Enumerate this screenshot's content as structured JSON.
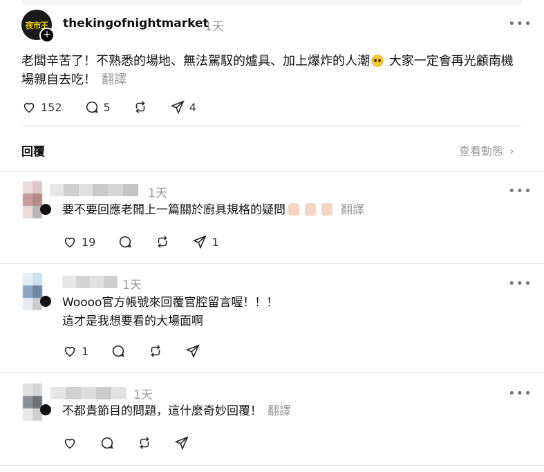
{
  "post": {
    "username": "thekingofnightmarket",
    "time": "1天",
    "avatar_text": "夜市王",
    "text": "老闆辛苦了！不熟悉的場地、無法駕馭的爐具、加上爆炸的人潮",
    "text_2": " 大家一定會再光顧南機場親自去吃！",
    "translate": "翻譯",
    "likes": "152",
    "comments": "5",
    "shares": "4"
  },
  "replies_header": "回覆",
  "activity_link": "查看動態",
  "comments": [
    {
      "time": "1天",
      "text": "要不要回應老闆上一篇關於廚具規格的疑問",
      "translate": "翻譯",
      "likes": "19",
      "comments": "",
      "reposts": "",
      "shares": "1"
    },
    {
      "time": "1天",
      "text": "Woooo官方帳號來回覆官腔留言喔！！！",
      "text_2": "這才是我想要看的大場面啊",
      "likes": "1"
    },
    {
      "time": "1天",
      "text": "不都貴節目的問題，這什麼奇妙回覆！",
      "translate": "翻譯"
    }
  ],
  "icons": [
    "heart-icon",
    "comment-icon",
    "repost-icon",
    "share-icon",
    "more-icon",
    "chevron-right-icon",
    "plus-icon"
  ]
}
